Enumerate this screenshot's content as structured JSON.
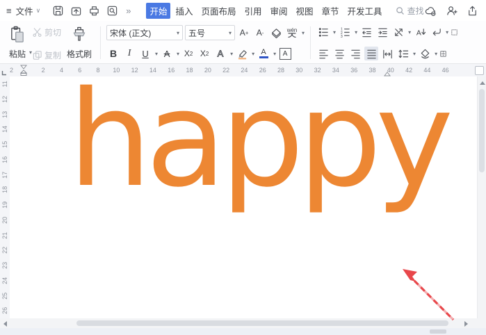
{
  "menubar": {
    "file": "文件",
    "more_glyph": "»",
    "tabs": [
      {
        "label": "开始",
        "active": true
      },
      {
        "label": "插入"
      },
      {
        "label": "页面布局"
      },
      {
        "label": "引用"
      },
      {
        "label": "审阅"
      },
      {
        "label": "视图"
      },
      {
        "label": "章节"
      },
      {
        "label": "开发工具"
      }
    ],
    "search": "查找"
  },
  "toolbar": {
    "paste": "粘贴",
    "cut": "剪切",
    "copy": "复制",
    "format_painter": "格式刷",
    "font_name": "宋体 (正文)",
    "font_size": "五号",
    "grow_letter": "A",
    "grow_sign": "+",
    "shrink_letter": "A",
    "shrink_sign": "-",
    "pinyin": "wén",
    "bold": "B",
    "italic": "I",
    "underline": "U",
    "strike": "A",
    "superscript_base": "X",
    "superscript_mark": "2",
    "subscript_base": "X",
    "subscript_mark": "2",
    "effect": "A",
    "font_color_letter": "A",
    "char_border_letter": "A"
  },
  "ruler": {
    "pre": "2",
    "h_numbers": [
      "2",
      "4",
      "6",
      "8",
      "10",
      "12",
      "14",
      "16",
      "18",
      "20",
      "22",
      "24",
      "26",
      "28",
      "30",
      "32",
      "34",
      "36",
      "38",
      "40",
      "42",
      "44",
      "46"
    ],
    "v_numbers": [
      "11",
      "12",
      "13",
      "14",
      "15",
      "16",
      "17",
      "18",
      "19",
      "20",
      "21",
      "22",
      "23",
      "24",
      "25",
      "26"
    ]
  },
  "document": {
    "text": "happy"
  },
  "colors": {
    "accent_tab_bg": "#4a79e3",
    "happy_orange": "#ED8733",
    "arrow_red": "#E8474B",
    "arrow_pink": "#F4AEB1",
    "font_color_bar": "#2F54C4",
    "highlight_tip": "#F2B27E"
  }
}
